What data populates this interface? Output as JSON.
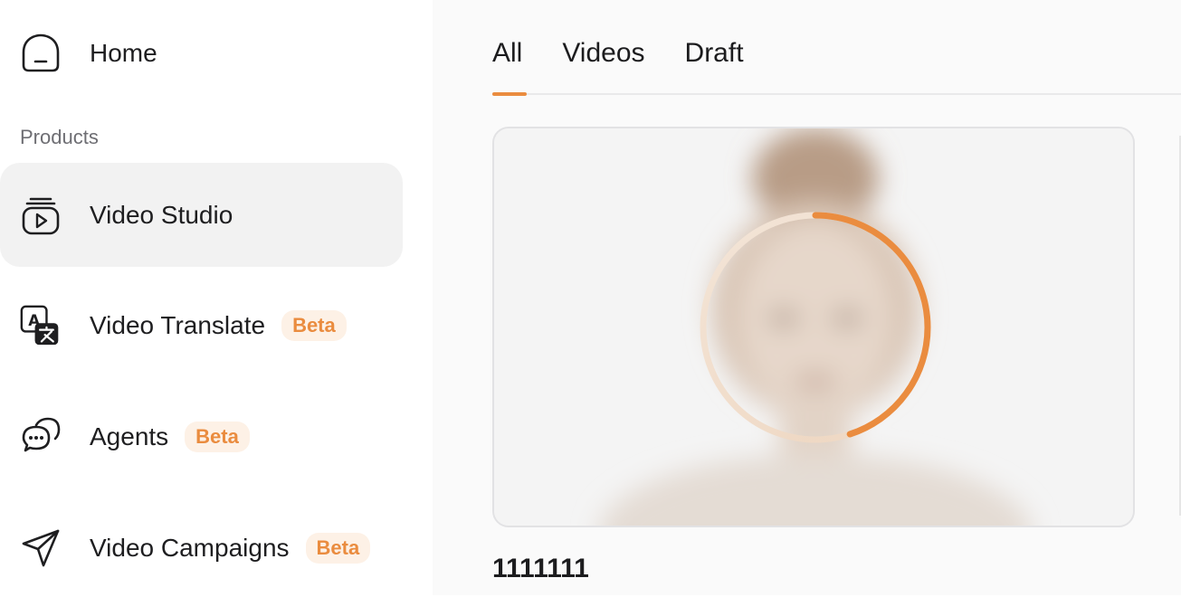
{
  "sidebar": {
    "home_label": "Home",
    "section_label": "Products",
    "items": [
      {
        "label": "Video Studio",
        "icon": "video-stack-icon",
        "active": true
      },
      {
        "label": "Video Translate",
        "icon": "translate-icon",
        "badge": "Beta"
      },
      {
        "label": "Agents",
        "icon": "chat-bubbles-icon",
        "badge": "Beta"
      },
      {
        "label": "Video Campaigns",
        "icon": "paper-plane-icon",
        "badge": "Beta"
      }
    ]
  },
  "main": {
    "tabs": [
      {
        "label": "All",
        "active": true
      },
      {
        "label": "Videos"
      },
      {
        "label": "Draft"
      }
    ],
    "card": {
      "title": "1111111",
      "progress": 0.45
    }
  },
  "colors": {
    "accent": "#ea8c3f",
    "badge_bg": "#fdf1e6",
    "active_bg": "#f2f2f2",
    "main_bg": "#fafafa"
  }
}
